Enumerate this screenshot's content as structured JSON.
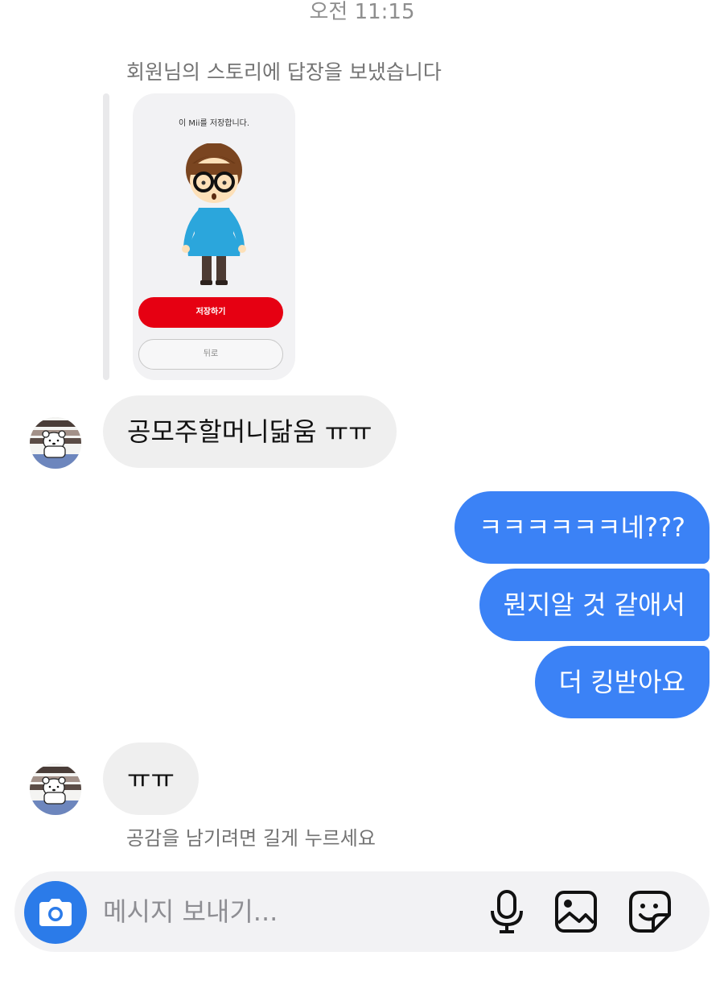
{
  "chat": {
    "timestamp": "오전 11:15",
    "story_reply_note": "회원님의 스토리에 답장을 보냈습니다",
    "story_card": {
      "title": "이 Mii를 저장합니다.",
      "save_label": "저장하기",
      "back_label": "뒤로"
    },
    "messages": [
      {
        "sender": "other",
        "text": "공모주할머니닮움 ㅠㅠ"
      },
      {
        "sender": "me",
        "text": "ㅋㅋㅋㅋㅋㅋ네???"
      },
      {
        "sender": "me",
        "text": "뭔지알 것 같애서"
      },
      {
        "sender": "me",
        "text": "더 킹받아요"
      },
      {
        "sender": "other",
        "text": "ㅠㅠ"
      }
    ],
    "reaction_hint": "공감을 남기려면 길게 누르세요"
  },
  "composer": {
    "placeholder": "메시지 보내기...",
    "icons": [
      "camera-icon",
      "microphone-icon",
      "gallery-icon",
      "sticker-icon"
    ]
  },
  "colors": {
    "outgoing_bubble": "#3b82f6",
    "incoming_bubble": "#efefef",
    "camera_button": "#2b7be9",
    "save_button": "#e60012"
  }
}
